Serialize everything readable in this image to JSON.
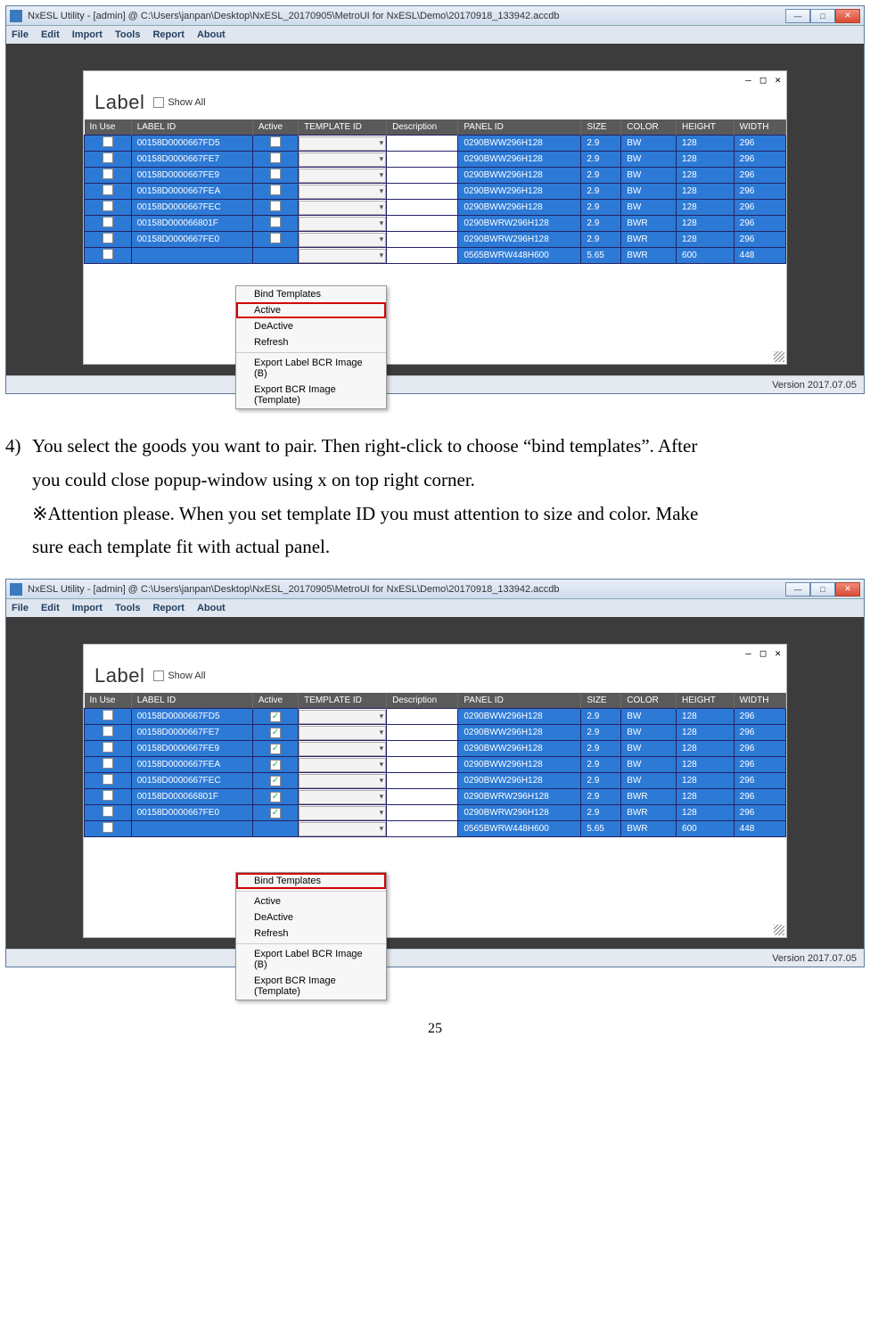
{
  "window": {
    "title": "NxESL Utility - [admin] @ C:\\Users\\janpan\\Desktop\\NxESL_20170905\\MetroUI for NxESL\\Demo\\20170918_133942.accdb",
    "min_label": "—",
    "max_label": "□",
    "close_label": "✕"
  },
  "menu": {
    "file": "File",
    "edit": "Edit",
    "import": "Import",
    "tools": "Tools",
    "report": "Report",
    "about": "About"
  },
  "inner": {
    "min_label": "—",
    "max_label": "□",
    "close_label": "✕",
    "title": "Label",
    "show_all": "Show All"
  },
  "columns": [
    "In Use",
    "LABEL ID",
    "Active",
    "TEMPLATE ID",
    "Description",
    "PANEL ID",
    "SIZE",
    "COLOR",
    "HEIGHT",
    "WIDTH"
  ],
  "rows1": [
    {
      "label": "00158D0000667FD5",
      "panel": "0290BWW296H128",
      "size": "2.9",
      "color": "BW",
      "h": "128",
      "w": "296"
    },
    {
      "label": "00158D0000667FE7",
      "panel": "0290BWW296H128",
      "size": "2.9",
      "color": "BW",
      "h": "128",
      "w": "296"
    },
    {
      "label": "00158D0000667FE9",
      "panel": "0290BWW296H128",
      "size": "2.9",
      "color": "BW",
      "h": "128",
      "w": "296"
    },
    {
      "label": "00158D0000667FEA",
      "panel": "0290BWW296H128",
      "size": "2.9",
      "color": "BW",
      "h": "128",
      "w": "296"
    },
    {
      "label": "00158D0000667FEC",
      "panel": "0290BWW296H128",
      "size": "2.9",
      "color": "BW",
      "h": "128",
      "w": "296"
    },
    {
      "label": "00158D000066801F",
      "panel": "0290BWRW296H128",
      "size": "2.9",
      "color": "BWR",
      "h": "128",
      "w": "296"
    },
    {
      "label": "00158D0000667FE0",
      "panel": "0290BWRW296H128",
      "size": "2.9",
      "color": "BWR",
      "h": "128",
      "w": "296"
    },
    {
      "label": "",
      "panel": "0565BWRW448H600",
      "size": "5.65",
      "color": "BWR",
      "h": "600",
      "w": "448"
    }
  ],
  "ctx": {
    "bind": "Bind Templates",
    "active": "Active",
    "deactive": "DeActive",
    "refresh": "Refresh",
    "export_b": "Export Label BCR Image (B)",
    "export_t": "Export BCR Image (Template)"
  },
  "version": "Version 2017.07.05",
  "doc": {
    "num": "4)",
    "line1": "You select the goods you want to pair. Then right-click to choose “bind templates”. After",
    "line2": "you could close popup-window using x on top right corner.",
    "line3": "※Attention please. When you set template ID you must attention to size and color. Make",
    "line4": "sure each template fit with actual panel."
  },
  "page_num": "25"
}
